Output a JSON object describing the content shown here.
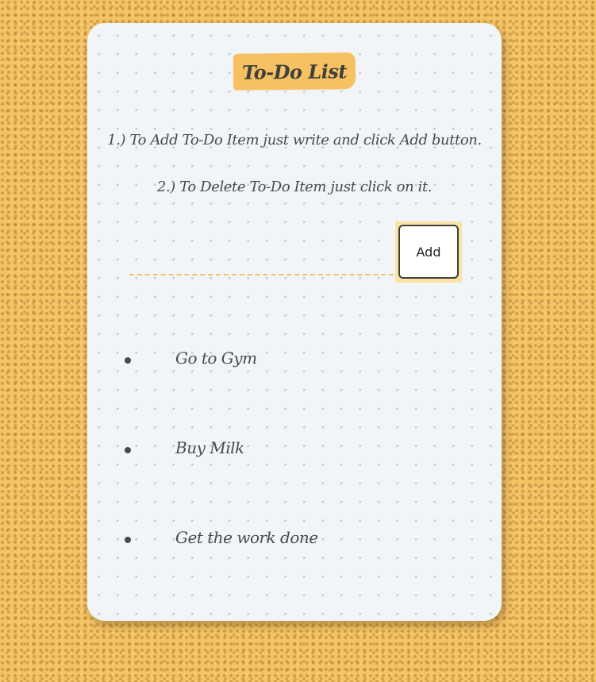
{
  "app": {
    "title": "To-Do List"
  },
  "instructions": [
    "1.) To Add To-Do Item just write and click Add button.",
    "2.) To Delete To-Do Item just click on it."
  ],
  "input": {
    "value": "",
    "placeholder": ""
  },
  "add_button": {
    "label": "Add"
  },
  "todo_items": [
    {
      "text": "Go to Gym"
    },
    {
      "text": "Buy Milk"
    },
    {
      "text": "Get the work done"
    }
  ],
  "colors": {
    "background": "#f3c364",
    "card": "#f1f5f8",
    "accent": "#f6c160",
    "text": "#4a4a4a"
  }
}
